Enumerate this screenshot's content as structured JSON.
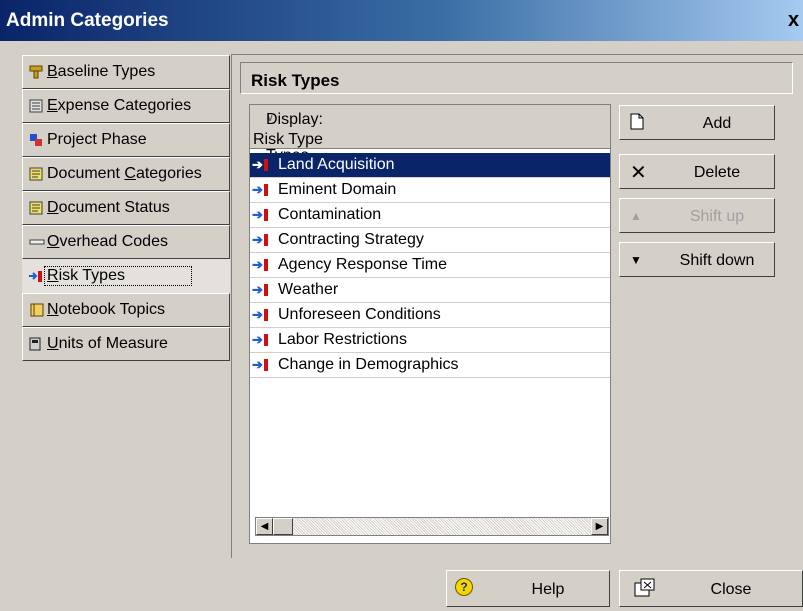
{
  "window": {
    "title": "Admin Categories",
    "close_glyph": "x"
  },
  "sidebar": {
    "items": [
      {
        "label_pre": "",
        "mnemonic": "B",
        "label_post": "aseline Types",
        "icon": "baseline-types-icon",
        "active": false
      },
      {
        "label_pre": "",
        "mnemonic": "E",
        "label_post": "xpense Categories",
        "icon": "expense-categories-icon",
        "active": false
      },
      {
        "label_pre": "Project Phase",
        "mnemonic": "",
        "label_post": "",
        "icon": "project-phase-icon",
        "active": false
      },
      {
        "label_pre": "Document ",
        "mnemonic": "C",
        "label_post": "ategories",
        "icon": "document-icon",
        "active": false
      },
      {
        "label_pre": "",
        "mnemonic": "D",
        "label_post": "ocument Status",
        "icon": "document-icon",
        "active": false
      },
      {
        "label_pre": "",
        "mnemonic": "O",
        "label_post": "verhead Codes",
        "icon": "overhead-codes-icon",
        "active": false
      },
      {
        "label_pre": "",
        "mnemonic": "R",
        "label_post": "isk Types",
        "icon": "risk-types-icon",
        "active": true
      },
      {
        "label_pre": "",
        "mnemonic": "N",
        "label_post": "otebook Topics",
        "icon": "notebook-icon",
        "active": false
      },
      {
        "label_pre": "",
        "mnemonic": "U",
        "label_post": "nits of Measure",
        "icon": "units-icon",
        "active": false
      }
    ]
  },
  "main": {
    "title": "Risk Types",
    "display_header": "Display: Risk Types",
    "column_header": "Risk Type",
    "rows": [
      {
        "label": "Land Acquisition",
        "selected": true
      },
      {
        "label": "Eminent Domain",
        "selected": false
      },
      {
        "label": "Contamination",
        "selected": false
      },
      {
        "label": "Contracting Strategy",
        "selected": false
      },
      {
        "label": "Agency Response Time",
        "selected": false
      },
      {
        "label": "Weather",
        "selected": false
      },
      {
        "label": "Unforeseen Conditions",
        "selected": false
      },
      {
        "label": "Labor Restrictions",
        "selected": false
      },
      {
        "label": "Change in Demographics",
        "selected": false
      }
    ]
  },
  "actions": {
    "add": "Add",
    "delete": "Delete",
    "shift_up": "Shift up",
    "shift_down": "Shift down"
  },
  "footer": {
    "help": "Help",
    "close": "Close"
  },
  "colors": {
    "selection": "#0a246a",
    "face": "#d4d0c8",
    "titlebar": "#0a246a"
  }
}
